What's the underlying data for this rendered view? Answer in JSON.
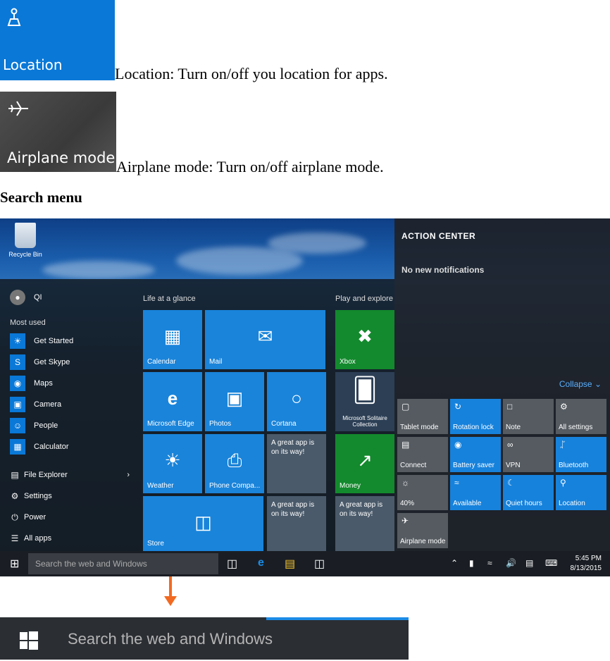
{
  "location_tile": {
    "label": "Location",
    "caption": "Location: Turn on/off you location for apps."
  },
  "airplane_tile": {
    "label": "Airplane mode",
    "caption": "Airplane mode: Turn on/off airplane mode.",
    "partial_right_chars": "A\n("
  },
  "heading": "Search menu",
  "desktop": {
    "recycle_bin": "Recycle Bin"
  },
  "start_menu": {
    "user": "QI",
    "most_used_title": "Most used",
    "most_used": [
      "Get Started",
      "Get Skype",
      "Maps",
      "Camera",
      "People",
      "Calculator"
    ],
    "places": [
      "File Explorer",
      "Settings",
      "Power",
      "All apps"
    ],
    "group1_title": "Life at a glance",
    "group2_title": "Play and explore",
    "tiles": {
      "calendar": "Calendar",
      "mail": "Mail",
      "edge": "Microsoft Edge",
      "photos": "Photos",
      "cortana": "Cortana",
      "weather": "Weather",
      "phone": "Phone Compa...",
      "promo1": "A great app is on its way!",
      "store": "Store",
      "promo2": "A great app is on its way!",
      "xbox": "Xbox",
      "solitaire": "Microsoft Solitaire Collection",
      "money": "Money",
      "promo3": "A great app is on its way!"
    }
  },
  "action_center": {
    "title": "ACTION CENTER",
    "empty": "No new notifications",
    "collapse": "Collapse",
    "quick_actions": [
      "Tablet mode",
      "Rotation lock",
      "Note",
      "All settings",
      "Connect",
      "Battery saver",
      "VPN",
      "Bluetooth",
      "40%",
      "Available",
      "Quiet hours",
      "Location",
      "Airplane mode"
    ]
  },
  "taskbar": {
    "search_placeholder": "Search the web and Windows",
    "time": "5:45 PM",
    "date": "8/13/2015"
  },
  "search_bar": {
    "placeholder": "Search the web and Windows"
  },
  "colors": {
    "accent": "#0a78d7",
    "arrow": "#f26a21",
    "green": "#138a2d"
  }
}
